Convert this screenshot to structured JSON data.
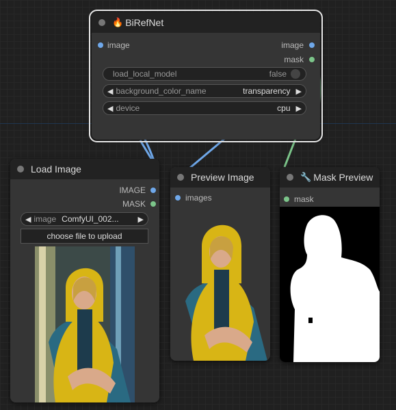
{
  "canvas": {
    "grid_color": "#272727",
    "link_colors": {
      "image": "#6fa8ea",
      "mask": "#7cc58a"
    }
  },
  "birefnet": {
    "icon": "fire-icon",
    "icon_glyph": "🔥",
    "title": "BiRefNet",
    "inputs": [
      {
        "label": "image",
        "color": "#6fa8ea"
      }
    ],
    "outputs": [
      {
        "label": "image",
        "color": "#6fa8ea"
      },
      {
        "label": "mask",
        "color": "#7cc58a"
      }
    ],
    "widgets": {
      "load_local_model": {
        "label": "load_local_model",
        "value": "false"
      },
      "background_color_name": {
        "label": "background_color_name",
        "value": "transparency"
      },
      "device": {
        "label": "device",
        "value": "cpu"
      }
    }
  },
  "load_image": {
    "title": "Load Image",
    "outputs": [
      {
        "label": "IMAGE",
        "color": "#6fa8ea"
      },
      {
        "label": "MASK",
        "color": "#7cc58a"
      }
    ],
    "image_widget": {
      "label": "image",
      "value": "ComfyUI_002..."
    },
    "upload_label": "choose file to upload"
  },
  "preview_image": {
    "title": "Preview Image",
    "inputs": [
      {
        "label": "images",
        "color": "#6fa8ea"
      }
    ]
  },
  "mask_preview": {
    "icon": "wrench-icon",
    "icon_glyph": "🔧",
    "title": "Mask Preview",
    "inputs": [
      {
        "label": "mask",
        "color": "#7cc58a"
      }
    ]
  }
}
